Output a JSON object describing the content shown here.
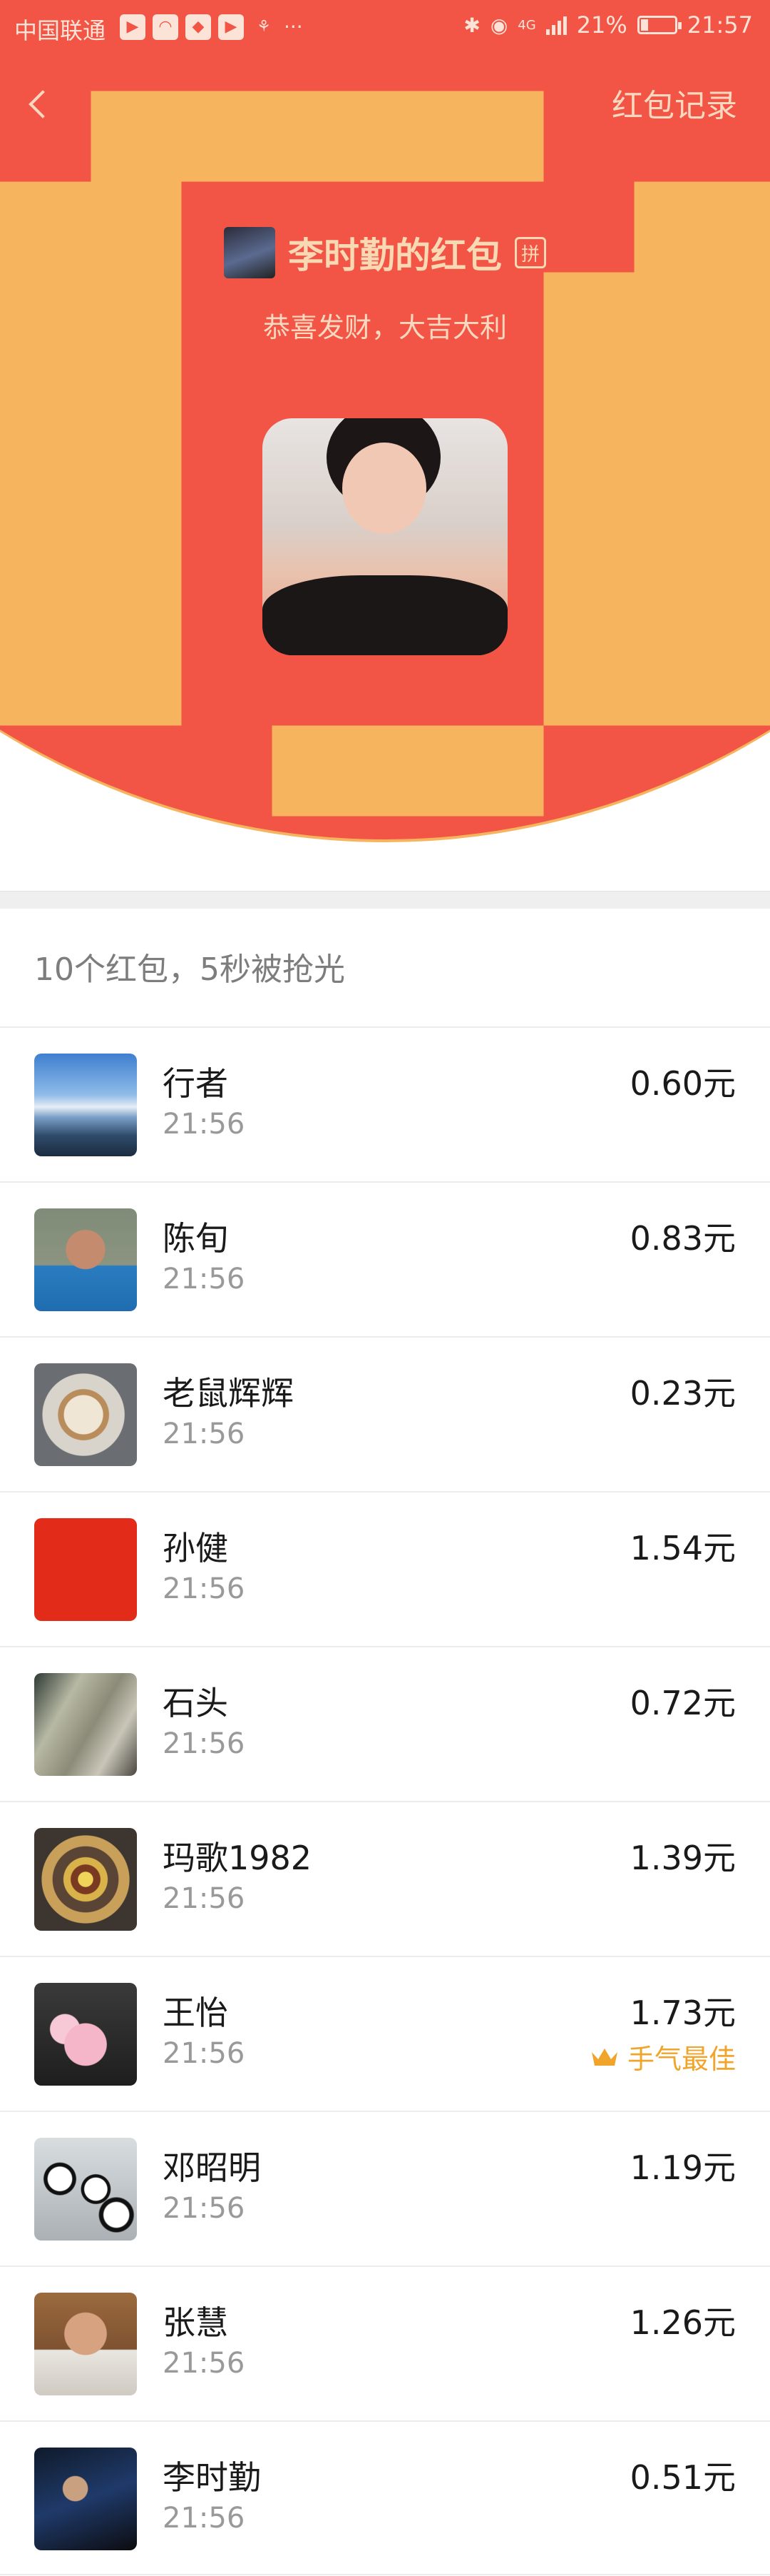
{
  "status_bar": {
    "carrier": "中国联通",
    "network": "4G",
    "battery": "21%",
    "battery_level": 0.21,
    "time": "21:57"
  },
  "nav": {
    "record_label": "红包记录"
  },
  "header": {
    "sender_name": "李时勤的红包",
    "pin_label": "拼",
    "greeting": "恭喜发财，大吉大利"
  },
  "summary": "10个红包，5秒被抢光",
  "recipients": [
    {
      "name": "行者",
      "time": "21:56",
      "amount": "0.60元"
    },
    {
      "name": "陈旬",
      "time": "21:56",
      "amount": "0.83元"
    },
    {
      "name": "老鼠辉辉",
      "time": "21:56",
      "amount": "0.23元"
    },
    {
      "name": "孙健",
      "time": "21:56",
      "amount": "1.54元"
    },
    {
      "name": "石头",
      "time": "21:56",
      "amount": "0.72元"
    },
    {
      "name": "玛歌1982",
      "time": "21:56",
      "amount": "1.39元"
    },
    {
      "name": "王怡",
      "time": "21:56",
      "amount": "1.73元",
      "badge": "手气最佳"
    },
    {
      "name": "邓昭明",
      "time": "21:56",
      "amount": "1.19元"
    },
    {
      "name": "张慧",
      "time": "21:56",
      "amount": "1.26元"
    },
    {
      "name": "李时勤",
      "time": "21:56",
      "amount": "0.51元"
    }
  ],
  "colors": {
    "header_red": "#f25545",
    "best_luck_gold": "#f0a52a"
  }
}
